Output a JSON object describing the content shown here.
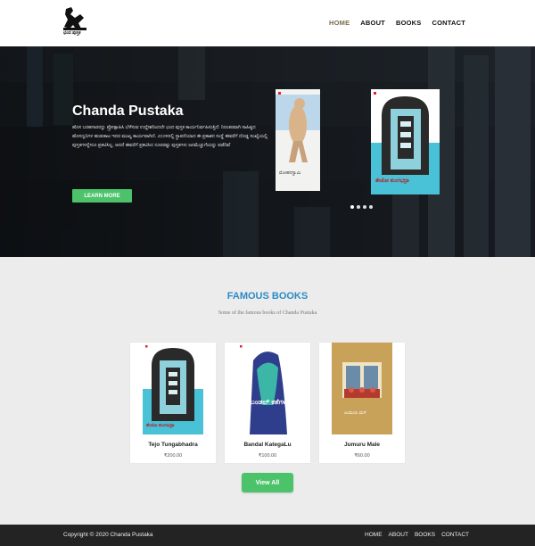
{
  "header": {
    "logo_text": "ಛಂದ ಪುಸ್ತಕ",
    "nav": [
      {
        "label": "HOME",
        "active": true
      },
      {
        "label": "ABOUT",
        "active": false
      },
      {
        "label": "BOOKS",
        "active": false
      },
      {
        "label": "CONTACT",
        "active": false
      }
    ]
  },
  "hero": {
    "title": "Chanda Pustaka",
    "description": "ಹೊಸ ಬರಹಗಾರರನ್ನು ಪ್ರೋತ್ಸಾಹಿಸಿ ಬೆಳೆಸುವ ಉದ್ದೇಶದಿಂದಲೇ ಛಂದ ಪುಸ್ತಕ ಕಾರ್ಯನಿರ್ವಹಿಸುತ್ತಿದೆ. ನಿರಂತರವಾಗಿ ಸಾಹಿತ್ಯದ ಹೊಸದ್ವನಿಗಳ ಹುಡುಕಾಟ ಇದರ ಮುಖ್ಯ ಕಾರ್ಯವಾಗಿದೆ. ೨೦೦೪ರಲ್ಲಿ ಸ್ಥಾಪನೆಯಾದ ಈ ಪ್ರಕಾಶನ ಸಂಸ್ಥೆ ಈವರೆಗೆ ದೊಡ್ಡ ಸಂಖ್ಯೆಯಲ್ಲಿ ಪುಸ್ತಕಗಳನ್ನೇನೂ ಪ್ರಕಟಿಸಿಲ್ಲ. ಆದರೆ ಈವರೆಗೆ ಪ್ರಕಟಿಸಿದ ನೂರರಷ್ಟು ಪುಸ್ತಕಗಳು ಜನಮೆಚ್ಚುಗೆಯನ್ನು ಪಡೆದಿವೆ",
    "button_label": "LEARN MORE",
    "slider_covers": [
      {
        "title": "ಮೋಹನಸ್ವಾಮಿ",
        "author": "ವಸುಧೇಂದ್ರ"
      },
      {
        "title": "ತೇಜೋ ತುಂಗಭದ್ರಾ",
        "author": "ವಸುಧೇಂದ್ರ"
      }
    ],
    "slider_dots": 4,
    "active_dot": 0
  },
  "famous": {
    "title": "FAMOUS BOOKS",
    "subtitle": "Some of the famous books of Chanda Pustaka",
    "books": [
      {
        "title": "Tejo Tungabhadra",
        "price": "₹200.00",
        "cover_title": "ತೇಜೋ ತುಂಗಭದ್ರಾ"
      },
      {
        "title": "Bandal KategaLu",
        "price": "₹100.00",
        "cover_title": "ಬಂಡಲ್ ಕತೆಗಳು"
      },
      {
        "title": "Jumuru Male",
        "price": "₹60.00",
        "cover_title": "ಜುಮುರು ಮಳೆ"
      }
    ],
    "view_all_label": "View All"
  },
  "footer": {
    "copyright": "Copyright © 2020 Chanda Pustaka",
    "nav": [
      "HOME",
      "ABOUT",
      "BOOKS",
      "CONTACT"
    ]
  },
  "colors": {
    "accent_green": "#4cc36a",
    "title_blue": "#2b8bc6",
    "footer_bg": "#232323",
    "section_bg": "#ececec"
  }
}
